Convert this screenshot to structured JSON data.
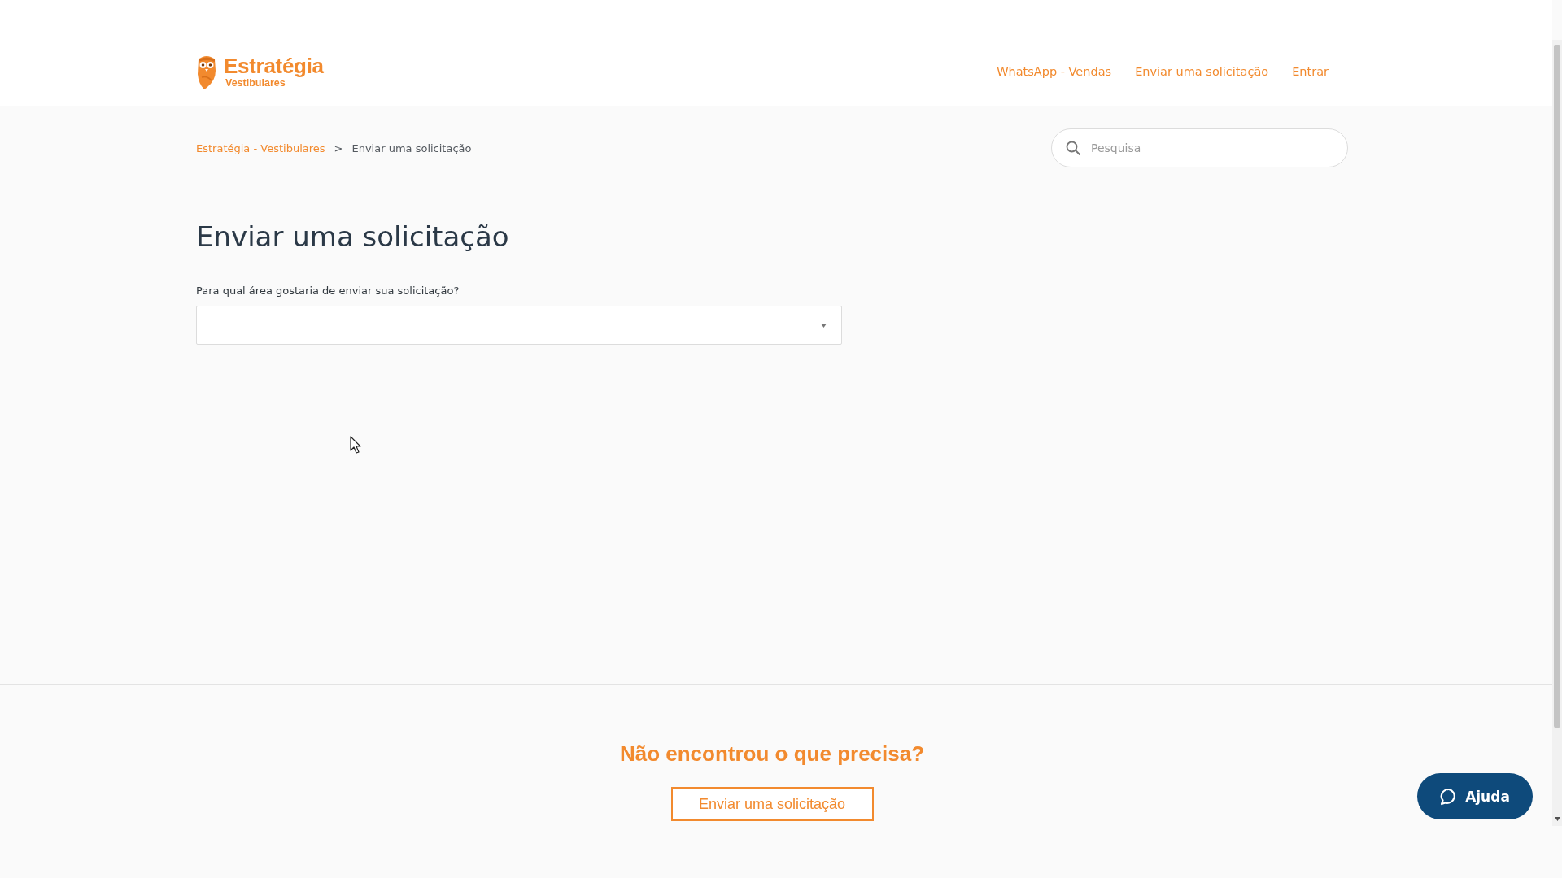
{
  "header": {
    "logo": {
      "name": "Estratégia",
      "subtitle": "Vestibulares"
    },
    "nav_links": [
      "WhatsApp - Vendas",
      "Enviar uma solicitação",
      "Entrar"
    ]
  },
  "breadcrumb": {
    "separator": ">",
    "items": [
      {
        "label": "Estratégia - Vestibulares",
        "kind": "link"
      },
      {
        "label": "Enviar uma solicitação",
        "kind": "current"
      }
    ]
  },
  "search": {
    "placeholder": "Pesquisa"
  },
  "page": {
    "title": "Enviar uma solicitação",
    "form": {
      "label": "Para qual área gostaria de enviar sua solicitação?",
      "select": {
        "value": "-"
      }
    }
  },
  "footer": {
    "heading": "Não encontrou o que precisa?",
    "button": "Enviar uma solicitação"
  },
  "help_widget": {
    "label": "Ajuda"
  }
}
